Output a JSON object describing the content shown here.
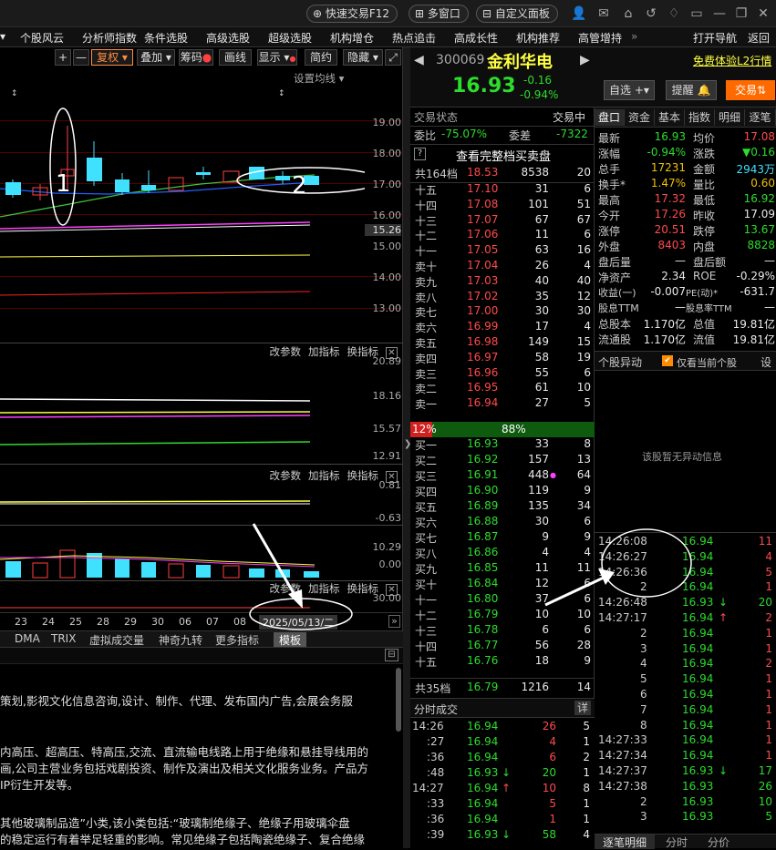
{
  "topbar": {
    "quick_trade": "快速交易F12",
    "multi_window": "多窗口",
    "custom_panel": "自定义面板"
  },
  "menu": {
    "items": [
      "个股风云",
      "分析师指数",
      "条件选股",
      "高级选股",
      "超级选股",
      "机构增仓",
      "热点追击",
      "高成长性",
      "机构推荐",
      "高管增持",
      "»"
    ],
    "open_nav": "打开导航",
    "back": "返回"
  },
  "chart_toolbar": {
    "restore": "复权",
    "overlay": "叠加",
    "chips": "筹码",
    "draw": "画线",
    "show": "显示",
    "simple": "简约",
    "hide": "隐藏",
    "ma_setting": "设置均线"
  },
  "price_axis": [
    "19.00",
    "18.00",
    "17.00",
    "16.00",
    "15.26",
    "15.00",
    "14.00",
    "13.00"
  ],
  "panels": {
    "change_param": "改参数",
    "add_indicator": "加指标",
    "switch_indicator": "换指标"
  },
  "panel2_axis": [
    "20.89",
    "18.16",
    "15.57",
    "12.91"
  ],
  "panel3_axis": [
    "0.81",
    "-0.63"
  ],
  "panel4_axis": [
    "10.29",
    "0.00"
  ],
  "panel5_axis": [
    "30.00"
  ],
  "date_axis": [
    "23",
    "24",
    "25",
    "28",
    "29",
    "30",
    "06",
    "07",
    "08"
  ],
  "date_cursor": "2025/05/13/二",
  "annotations": {
    "label1": "1",
    "label2": "2"
  },
  "bottom_tabs": [
    "DMA",
    "TRIX",
    "虚拟成交量",
    "神奇九转",
    "更多指标",
    "模板"
  ],
  "text_lines": [
    "策划,影视文化信息咨询,设计、制作、代理、发布国内广告,会展会务服",
    "",
    "内高压、超高压、特高压,交流、直流输电线路上用于绝缘和悬挂导线用的",
    "画,公司主营业务包括戏剧投资、制作及演出及相关文化服务业务。产品方",
    "IP衍生开发等。",
    "",
    "其他玻璃制品造”小类,该小类包括:“玻璃制绝缘子、绝缘子用玻璃伞盘",
    "的稳定运行有着举足轻重的影响。常见绝缘子包括陶瓷绝缘子、复合绝缘"
  ],
  "stock": {
    "code": "300069",
    "name": "金利华电",
    "price": "16.93",
    "change": "-0.16",
    "change_pct": "-0.94%",
    "watch": "自选",
    "alert": "提醒",
    "trade": "交易",
    "free_trial": "免费体验L2行情"
  },
  "order_book": {
    "status_label": "交易状态",
    "status_value": "交易中",
    "ratio_label": "委比",
    "ratio_value": "-75.07%",
    "diff_label": "委差",
    "diff_value": "-7322",
    "view_full": "查看完整档买卖盘",
    "total_top": {
      "label": "共164档",
      "price": "18.53",
      "vol": "8538",
      "orders": "20"
    },
    "asks": [
      {
        "n": "十五",
        "p": "17.10",
        "v": "31",
        "o": "6"
      },
      {
        "n": "十四",
        "p": "17.08",
        "v": "101",
        "o": "51"
      },
      {
        "n": "十三",
        "p": "17.07",
        "v": "67",
        "o": "67"
      },
      {
        "n": "十二",
        "p": "17.06",
        "v": "11",
        "o": "6"
      },
      {
        "n": "十一",
        "p": "17.05",
        "v": "63",
        "o": "16"
      },
      {
        "n": "卖十",
        "p": "17.04",
        "v": "26",
        "o": "4"
      },
      {
        "n": "卖九",
        "p": "17.03",
        "v": "40",
        "o": "40"
      },
      {
        "n": "卖八",
        "p": "17.02",
        "v": "35",
        "o": "12"
      },
      {
        "n": "卖七",
        "p": "17.00",
        "v": "30",
        "o": "30"
      },
      {
        "n": "卖六",
        "p": "16.99",
        "v": "17",
        "o": "4"
      },
      {
        "n": "卖五",
        "p": "16.98",
        "v": "149",
        "o": "15"
      },
      {
        "n": "卖四",
        "p": "16.97",
        "v": "58",
        "o": "19"
      },
      {
        "n": "卖三",
        "p": "16.96",
        "v": "55",
        "o": "6"
      },
      {
        "n": "卖二",
        "p": "16.95",
        "v": "61",
        "o": "10"
      },
      {
        "n": "卖一",
        "p": "16.94",
        "v": "27",
        "o": "5"
      }
    ],
    "ratio_left": "12%",
    "ratio_right": "88%",
    "bids": [
      {
        "n": "买一",
        "p": "16.93",
        "v": "33",
        "o": "8"
      },
      {
        "n": "买二",
        "p": "16.92",
        "v": "157",
        "o": "13"
      },
      {
        "n": "买三",
        "p": "16.91",
        "v": "448",
        "o": "64"
      },
      {
        "n": "买四",
        "p": "16.90",
        "v": "119",
        "o": "9"
      },
      {
        "n": "买五",
        "p": "16.89",
        "v": "135",
        "o": "34"
      },
      {
        "n": "买六",
        "p": "16.88",
        "v": "30",
        "o": "6"
      },
      {
        "n": "买七",
        "p": "16.87",
        "v": "9",
        "o": "9"
      },
      {
        "n": "买八",
        "p": "16.86",
        "v": "4",
        "o": "4"
      },
      {
        "n": "买九",
        "p": "16.85",
        "v": "11",
        "o": "11"
      },
      {
        "n": "买十",
        "p": "16.84",
        "v": "12",
        "o": "6"
      },
      {
        "n": "十一",
        "p": "16.80",
        "v": "37",
        "o": "6"
      },
      {
        "n": "十二",
        "p": "16.79",
        "v": "10",
        "o": "10"
      },
      {
        "n": "十三",
        "p": "16.78",
        "v": "6",
        "o": "6"
      },
      {
        "n": "十四",
        "p": "16.77",
        "v": "56",
        "o": "28"
      },
      {
        "n": "十五",
        "p": "16.76",
        "v": "18",
        "o": "9"
      }
    ],
    "total_bottom": {
      "label": "共35档",
      "price": "16.79",
      "vol": "1216",
      "orders": "14"
    }
  },
  "tick": {
    "title": "分时成交",
    "detail": "详",
    "rows": [
      {
        "t": "14:26",
        "p": "16.94",
        "v": "26",
        "o": "5",
        "pc": "g",
        "vc": "r",
        "a": ""
      },
      {
        "t": ":27",
        "p": "16.94",
        "v": "4",
        "o": "1",
        "pc": "g",
        "vc": "r",
        "a": ""
      },
      {
        "t": ":36",
        "p": "16.94",
        "v": "6",
        "o": "2",
        "pc": "g",
        "vc": "r",
        "a": ""
      },
      {
        "t": ":48",
        "p": "16.93",
        "v": "20",
        "o": "1",
        "pc": "g",
        "vc": "g",
        "a": "↓"
      },
      {
        "t": "14:27",
        "p": "16.94",
        "v": "10",
        "o": "8",
        "pc": "g",
        "vc": "r",
        "a": "↑"
      },
      {
        "t": ":33",
        "p": "16.94",
        "v": "5",
        "o": "1",
        "pc": "g",
        "vc": "r",
        "a": ""
      },
      {
        "t": ":36",
        "p": "16.94",
        "v": "1",
        "o": "1",
        "pc": "g",
        "vc": "r",
        "a": ""
      },
      {
        "t": ":39",
        "p": "16.93",
        "v": "58",
        "o": "4",
        "pc": "g",
        "vc": "g",
        "a": "↓"
      }
    ]
  },
  "quote_tabs": [
    "盘口",
    "资金",
    "基本",
    "指数",
    "明细",
    "逐笔"
  ],
  "quote": [
    {
      "l": "最新",
      "v1": "16.93",
      "c1": "g",
      "l2": "均价",
      "v2": "17.08",
      "c2": "r"
    },
    {
      "l": "涨幅",
      "v1": "-0.94%",
      "c1": "g",
      "l2": "涨跌",
      "v2": "▼0.16",
      "c2": "g"
    },
    {
      "l": "总手",
      "v1": "17231",
      "c1": "y",
      "l2": "金额",
      "v2": "2943万",
      "c2": "c"
    },
    {
      "l": "换手*",
      "v1": "1.47%",
      "c1": "y",
      "l2": "量比",
      "v2": "0.60",
      "c2": "y"
    },
    {
      "l": "最高",
      "v1": "17.32",
      "c1": "r",
      "l2": "最低",
      "v2": "16.92",
      "c2": "g"
    },
    {
      "l": "今开",
      "v1": "17.26",
      "c1": "r",
      "l2": "昨收",
      "v2": "17.09",
      "c2": "w"
    },
    {
      "l": "涨停",
      "v1": "20.51",
      "c1": "r",
      "l2": "跌停",
      "v2": "13.67",
      "c2": "g"
    },
    {
      "l": "外盘",
      "v1": "8403",
      "c1": "r",
      "l2": "内盘",
      "v2": "8828",
      "c2": "g"
    },
    {
      "l": "盘后量",
      "v1": "—",
      "c1": "w",
      "l2": "盘后额",
      "v2": "—",
      "c2": "w"
    },
    {
      "l": "净资产",
      "v1": "2.34",
      "c1": "w",
      "l2": "ROE",
      "v2": "-0.29%",
      "c2": "w"
    },
    {
      "l": "收益(一)",
      "v1": "-0.007",
      "c1": "w",
      "l2": "PE(动)*",
      "v2": "-631.7",
      "c2": "w"
    },
    {
      "l": "股息TTM",
      "v1": "—",
      "c1": "w",
      "l2": "股息率TTM",
      "v2": "—",
      "c2": "w"
    },
    {
      "l": "总股本",
      "v1": "1.170亿",
      "c1": "w",
      "l2": "总值",
      "v2": "19.81亿",
      "c2": "w"
    },
    {
      "l": "流通股",
      "v1": "1.170亿",
      "c1": "w",
      "l2": "流值",
      "v2": "19.81亿",
      "c2": "w"
    }
  ],
  "anomaly": {
    "title": "个股异动",
    "only_current": "仅看当前个股",
    "settings": "设",
    "empty": "该股暂无异动信息"
  },
  "trades": [
    {
      "t": "14:26:08",
      "p": "16.94",
      "v": "11",
      "pc": "g",
      "vc": "r",
      "a": ""
    },
    {
      "t": "14:26:27",
      "p": "16.94",
      "v": "4",
      "pc": "g",
      "vc": "r",
      "a": ""
    },
    {
      "t": "14:26:36",
      "p": "16.94",
      "v": "5",
      "pc": "g",
      "vc": "r",
      "a": ""
    },
    {
      "t": "2",
      "p": "16.94",
      "v": "1",
      "pc": "g",
      "vc": "r",
      "a": ""
    },
    {
      "t": "14:26:48",
      "p": "16.93",
      "v": "20",
      "pc": "g",
      "vc": "g",
      "a": "↓"
    },
    {
      "t": "14:27:17",
      "p": "16.94",
      "v": "2",
      "pc": "g",
      "vc": "r",
      "a": "↑"
    },
    {
      "t": "2",
      "p": "16.94",
      "v": "1",
      "pc": "g",
      "vc": "r",
      "a": ""
    },
    {
      "t": "3",
      "p": "16.94",
      "v": "1",
      "pc": "g",
      "vc": "r",
      "a": ""
    },
    {
      "t": "4",
      "p": "16.94",
      "v": "2",
      "pc": "g",
      "vc": "r",
      "a": ""
    },
    {
      "t": "5",
      "p": "16.94",
      "v": "1",
      "pc": "g",
      "vc": "r",
      "a": ""
    },
    {
      "t": "6",
      "p": "16.94",
      "v": "1",
      "pc": "g",
      "vc": "r",
      "a": ""
    },
    {
      "t": "7",
      "p": "16.94",
      "v": "1",
      "pc": "g",
      "vc": "r",
      "a": ""
    },
    {
      "t": "8",
      "p": "16.94",
      "v": "1",
      "pc": "g",
      "vc": "r",
      "a": ""
    },
    {
      "t": "14:27:33",
      "p": "16.94",
      "v": "1",
      "pc": "g",
      "vc": "r",
      "a": ""
    },
    {
      "t": "14:27:34",
      "p": "16.94",
      "v": "1",
      "pc": "g",
      "vc": "r",
      "a": ""
    },
    {
      "t": "14:27:37",
      "p": "16.93",
      "v": "17",
      "pc": "g",
      "vc": "g",
      "a": "↓"
    },
    {
      "t": "14:27:38",
      "p": "16.93",
      "v": "26",
      "pc": "g",
      "vc": "g",
      "a": ""
    },
    {
      "t": "2",
      "p": "16.93",
      "v": "10",
      "pc": "g",
      "vc": "g",
      "a": ""
    },
    {
      "t": "3",
      "p": "16.93",
      "v": "5",
      "pc": "g",
      "vc": "g",
      "a": ""
    }
  ],
  "bottom_right_tabs": [
    "逐笔明细",
    "分时",
    "分价"
  ]
}
